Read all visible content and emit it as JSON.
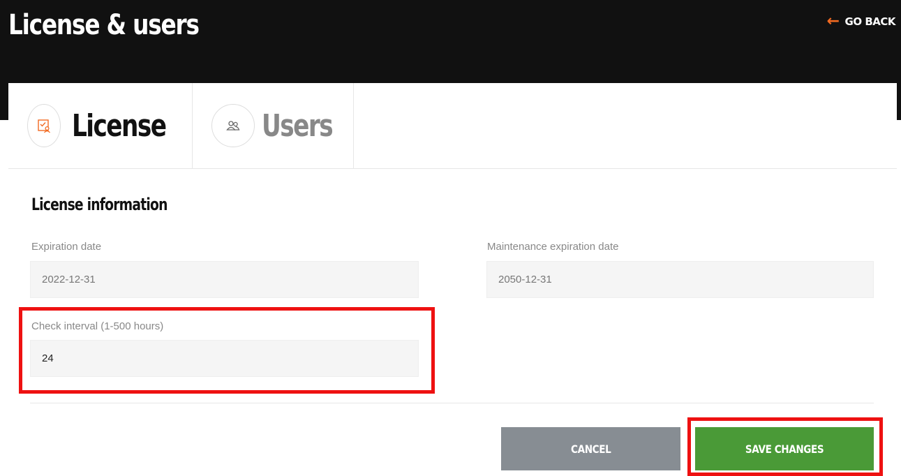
{
  "header": {
    "title": "License & users",
    "go_back": "GO BACK"
  },
  "tabs": [
    {
      "label": "License",
      "icon": "license-icon",
      "active": true
    },
    {
      "label": "Users",
      "icon": "users-icon",
      "active": false
    }
  ],
  "section": {
    "title": "License information"
  },
  "fields": {
    "expiration": {
      "label": "Expiration date",
      "value": "2022-12-31"
    },
    "maintenance": {
      "label": "Maintenance expiration date",
      "value": "2050-12-31"
    },
    "check_interval": {
      "label": "Check interval (1-500 hours)",
      "value": "24"
    }
  },
  "buttons": {
    "cancel": "CANCEL",
    "save": "SAVE CHANGES"
  },
  "colors": {
    "accent": "#f26a21",
    "header_bg": "#111111",
    "save": "#4a9a37",
    "cancel": "#878d93",
    "highlight": "#ee1111"
  }
}
